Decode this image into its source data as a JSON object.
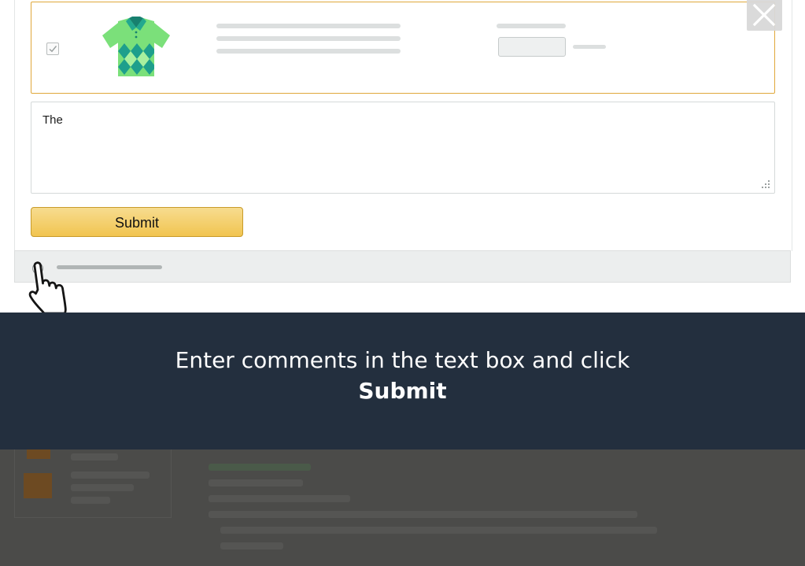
{
  "comment": {
    "value": "The"
  },
  "submit_button": {
    "label": "Submit"
  },
  "instruction": {
    "text": "Enter comments in the text box and click",
    "emphasis": "Submit"
  },
  "icons": {
    "close": "close-icon",
    "checkbox": "checkmark-icon",
    "product": "polo-shirt-icon",
    "pointer": "hand-pointer-icon",
    "resize": "resize-grip-icon"
  },
  "colors": {
    "banner_bg": "#232f3e",
    "highlight_border": "#e0a83b",
    "button_top": "#f7dc8f",
    "button_bottom": "#f1c450",
    "overlay": "#4b4b49"
  }
}
